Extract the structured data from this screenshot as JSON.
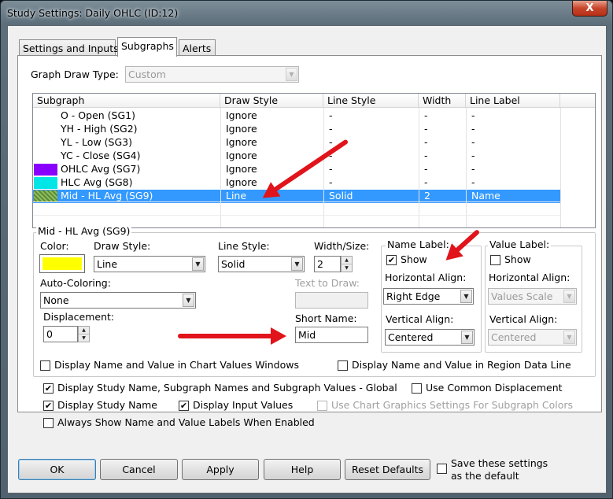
{
  "window": {
    "title": "Study Settings: Daily OHLC (ID:12)",
    "close_glyph": "X"
  },
  "tabs": [
    {
      "label": "Settings and Inputs"
    },
    {
      "label": "Subgraphs"
    },
    {
      "label": "Alerts"
    }
  ],
  "graph_draw_type": {
    "label": "Graph Draw Type:",
    "value": "Custom"
  },
  "subgraph_list": {
    "columns": [
      "Subgraph",
      "Draw Style",
      "Line Style",
      "Width",
      "Line Label"
    ],
    "rows": [
      {
        "name": "O - Open (SG1)",
        "draw_style": "Ignore",
        "line_style": "-",
        "width": "-",
        "line_label": "-",
        "color": ""
      },
      {
        "name": "YH - High (SG2)",
        "draw_style": "Ignore",
        "line_style": "-",
        "width": "-",
        "line_label": "-",
        "color": ""
      },
      {
        "name": "YL - Low (SG3)",
        "draw_style": "Ignore",
        "line_style": "-",
        "width": "-",
        "line_label": "-",
        "color": ""
      },
      {
        "name": "YC - Close (SG4)",
        "draw_style": "Ignore",
        "line_style": "-",
        "width": "-",
        "line_label": "-",
        "color": ""
      },
      {
        "name": "OHLC Avg (SG7)",
        "draw_style": "Ignore",
        "line_style": "-",
        "width": "-",
        "line_label": "-",
        "color": "#8a00ff"
      },
      {
        "name": "HLC Avg (SG8)",
        "draw_style": "Ignore",
        "line_style": "-",
        "width": "-",
        "line_label": "-",
        "color": "#00e5e5"
      },
      {
        "name": "Mid - HL Avg (SG9)",
        "draw_style": "Line",
        "line_style": "Solid",
        "width": "2",
        "line_label": "Name",
        "color": "#8fbf5a"
      }
    ]
  },
  "subgraph_group": {
    "title": "Mid - HL Avg (SG9)",
    "color_label": "Color:",
    "color_value": "#ffff00",
    "draw_style_label": "Draw Style:",
    "draw_style": "Line",
    "line_style_label": "Line Style:",
    "line_style": "Solid",
    "width_label": "Width/Size:",
    "width": "2",
    "auto_coloring_label": "Auto-Coloring:",
    "auto_coloring": "None",
    "text_to_draw_label": "Text to Draw:",
    "text_to_draw": "",
    "displacement_label": "Displacement:",
    "displacement": "0",
    "short_name_label": "Short Name:",
    "short_name": "Mid",
    "name_label_group": {
      "title": "Name Label:",
      "show_label": "Show",
      "show_checked": true,
      "h_align_label": "Horizontal Align:",
      "h_align": "Right Edge",
      "v_align_label": "Vertical Align:",
      "v_align": "Centered"
    },
    "value_label_group": {
      "title": "Value Label:",
      "show_label": "Show",
      "show_checked": false,
      "h_align_label": "Horizontal Align:",
      "h_align": "Values Scale",
      "v_align_label": "Vertical Align:",
      "v_align": "Centered"
    },
    "display_in_chart_values": "Display Name and Value in Chart Values Windows",
    "display_in_region_data": "Display Name and Value in Region Data Line"
  },
  "options": {
    "display_global": "Display Study Name, Subgraph Names and Subgraph Values - Global",
    "use_common_displacement": "Use Common Displacement",
    "display_study_name": "Display Study Name",
    "display_input_values": "Display Input Values",
    "use_chart_graphics": "Use Chart Graphics Settings For Subgraph Colors",
    "always_show_labels": "Always Show Name and Value Labels When Enabled"
  },
  "buttons": {
    "ok": "OK",
    "cancel": "Cancel",
    "apply": "Apply",
    "help": "Help",
    "reset": "Reset Defaults"
  },
  "save_default": {
    "line1": "Save these settings",
    "line2": "as the default"
  },
  "colors": {
    "selection": "#3399ff",
    "annotation_arrow": "#e0141a"
  }
}
